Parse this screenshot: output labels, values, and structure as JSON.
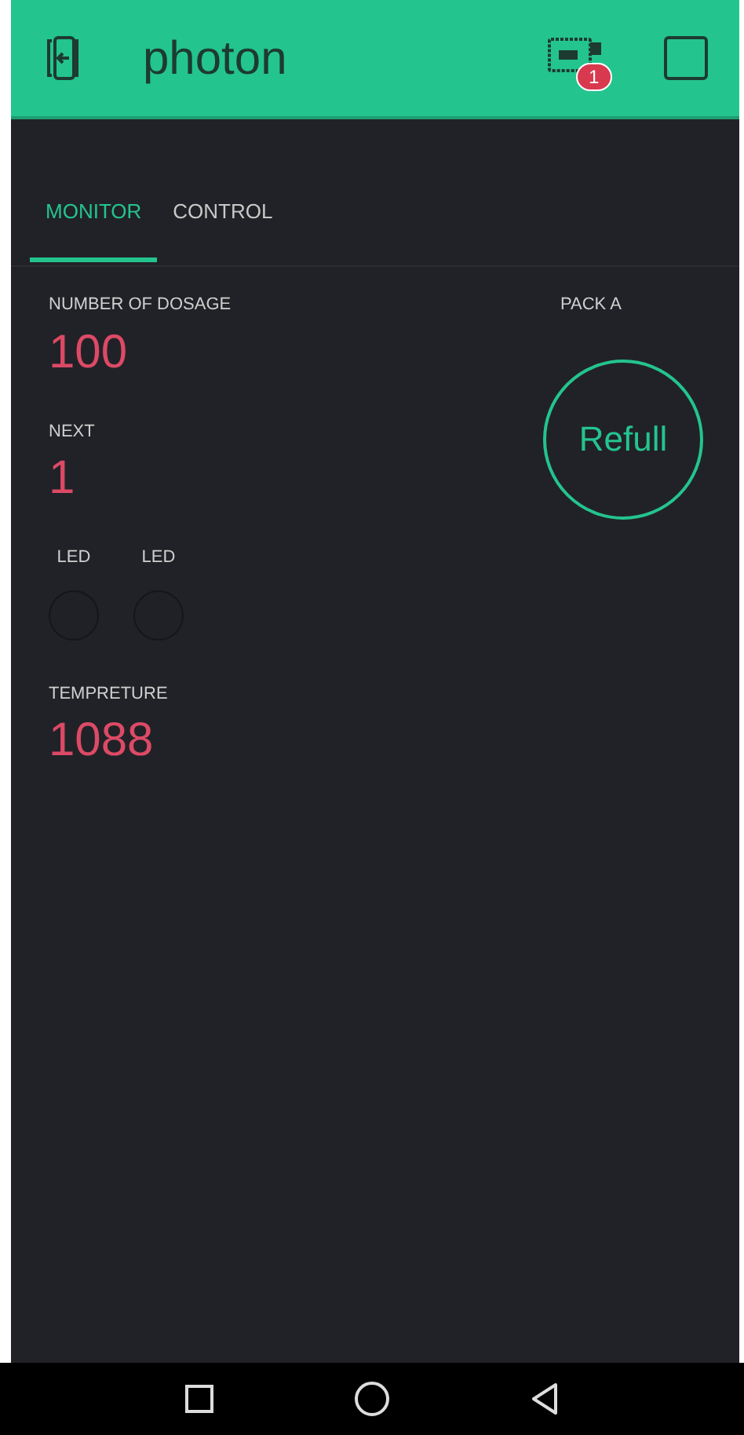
{
  "header": {
    "title": "photon",
    "badge": "1"
  },
  "tabs": [
    {
      "label": "MONITOR",
      "selected": true
    },
    {
      "label": "CONTROL",
      "selected": false
    }
  ],
  "widgets": [
    {
      "kind": "value",
      "label": "NUMBER OF DOSAGE",
      "value": "100"
    },
    {
      "kind": "value",
      "label": "NEXT",
      "value": "1"
    },
    {
      "kind": "leds",
      "leds": [
        {
          "label": "LED",
          "on": false
        },
        {
          "label": "LED",
          "on": false
        }
      ]
    },
    {
      "kind": "value",
      "label": "TEMPRETURE",
      "value": "1088"
    }
  ],
  "button": {
    "label": "PACK A",
    "text": "Refull"
  }
}
